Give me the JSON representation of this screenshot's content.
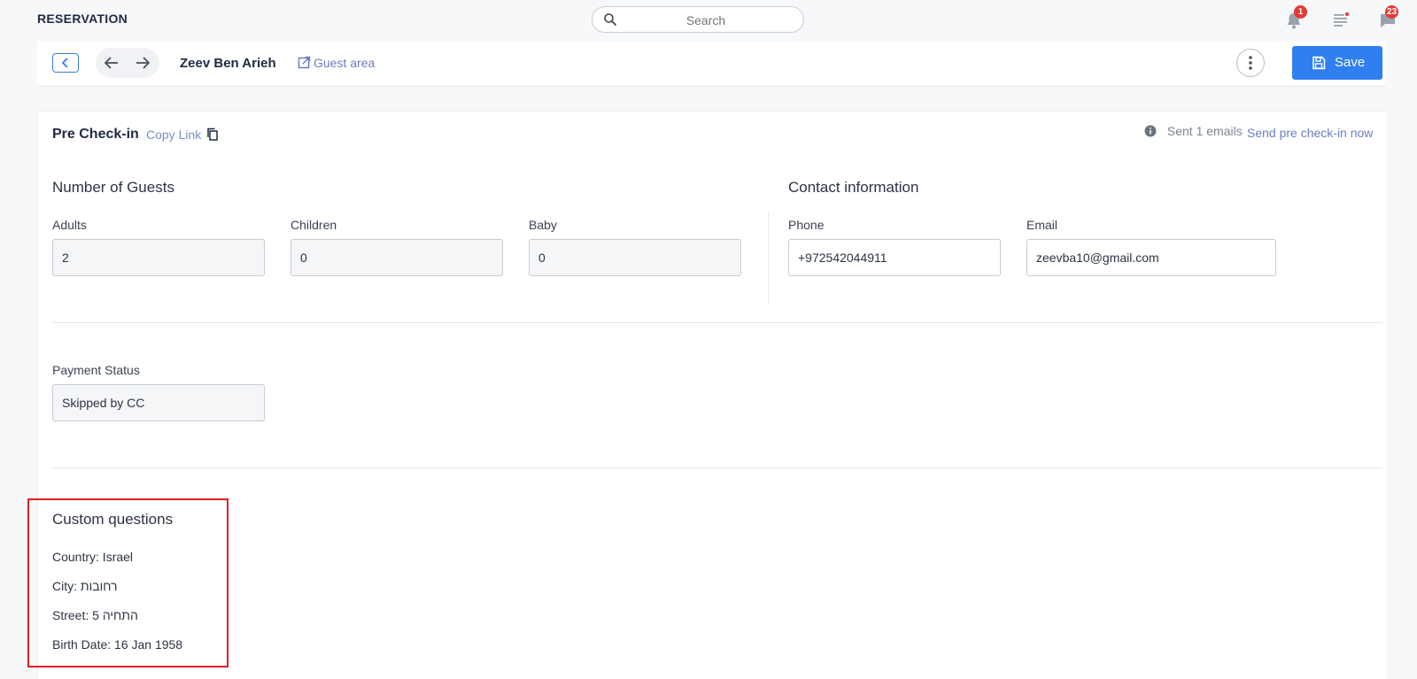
{
  "topbar": {
    "title": "RESERVATION",
    "search_placeholder": "Search",
    "notifications_count": "1",
    "messages_count": "23"
  },
  "header": {
    "guest_name": "Zeev Ben Arieh",
    "guest_area_label": "Guest area",
    "save_label": "Save"
  },
  "precheckin": {
    "title": "Pre Check-in",
    "copy_link_label": "Copy Link",
    "sent_emails": "Sent 1 emails",
    "send_now_label": "Send pre check-in now"
  },
  "guests": {
    "title": "Number of Guests",
    "adults_label": "Adults",
    "adults_value": "2",
    "children_label": "Children",
    "children_value": "0",
    "baby_label": "Baby",
    "baby_value": "0"
  },
  "contact": {
    "title": "Contact information",
    "phone_label": "Phone",
    "phone_value": "+972542044911",
    "email_label": "Email",
    "email_value": "zeevba10@gmail.com"
  },
  "payment": {
    "label": "Payment Status",
    "value": "Skipped by CC"
  },
  "custom_questions": {
    "title": "Custom questions",
    "items": [
      "Country: Israel",
      "City: רחובות",
      "Street: התחיה 5",
      "Birth Date: 16 Jan 1958"
    ]
  },
  "colors": {
    "primary": "#2f7ff0",
    "link": "#6a7ec4",
    "badge": "#e53935",
    "highlight_border": "#e02020"
  },
  "icons": [
    "search-icon",
    "bell-icon",
    "list-icon",
    "chat-icon",
    "chevron-left-icon",
    "arrow-left-icon",
    "arrow-right-icon",
    "external-link-icon",
    "more-vertical-icon",
    "save-icon",
    "copy-icon",
    "info-icon"
  ]
}
